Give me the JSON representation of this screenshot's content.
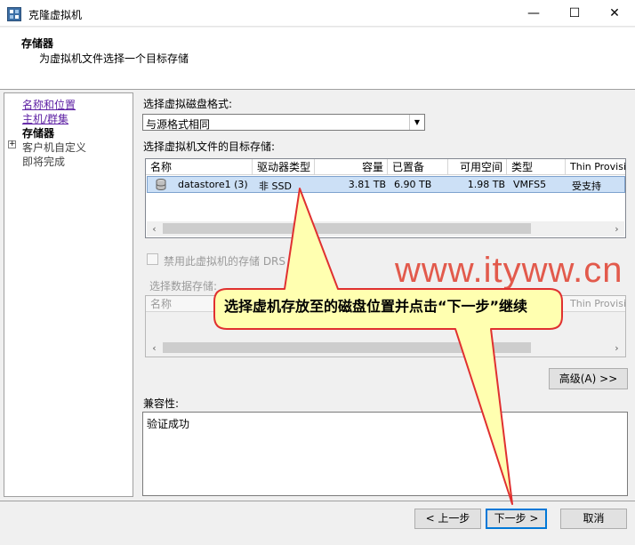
{
  "window": {
    "title": "克隆虚拟机",
    "minimize_glyph": "—",
    "maximize_glyph": "☐",
    "close_glyph": "✕"
  },
  "header": {
    "title": "存储器",
    "subtitle": "为虚拟机文件选择一个目标存储"
  },
  "nav": {
    "items": [
      {
        "label": "名称和位置",
        "state": "link"
      },
      {
        "label": "主机/群集",
        "state": "link"
      },
      {
        "label": "存储器",
        "state": "current"
      },
      {
        "label": "客户机自定义",
        "state": "pending",
        "expand": "+"
      },
      {
        "label": "即将完成",
        "state": "pending"
      }
    ]
  },
  "disk_format": {
    "label": "选择虚拟磁盘格式:",
    "value": "与源格式相同"
  },
  "target_storage": {
    "label": "选择虚拟机文件的目标存储:",
    "columns": [
      "名称",
      "驱动器类型",
      "容量",
      "已置备",
      "可用空间",
      "类型",
      "Thin Provisio"
    ],
    "rows": [
      {
        "name": "datastore1 (3)",
        "drive_type": "非 SSD",
        "capacity": "3.81 TB",
        "provisioned": "6.90 TB",
        "free": "1.98 TB",
        "type": "VMFS5",
        "thin": "受支持"
      }
    ]
  },
  "drs": {
    "label": "禁用此虚拟机的存储 DRS",
    "checked": false
  },
  "datastore_select": {
    "label": "选择数据存储:",
    "columns": [
      "名称",
      "Thin Provision"
    ]
  },
  "advanced_button": "高级(A) >>",
  "compat": {
    "label": "兼容性:",
    "text": "验证成功"
  },
  "footer": {
    "back": "< 上一步",
    "next": "下一步 >",
    "cancel": "取消"
  },
  "annotation": {
    "callout": "选择虚机存放至的磁盘位置并点击“下一步”继续",
    "watermark": "www.ityww.cn",
    "callout_fill": "#ffffb0",
    "callout_stroke": "#e03030"
  },
  "colors": {
    "selection": "#cce0f6",
    "link": "#5c1fa3",
    "focus": "#0078d7"
  }
}
